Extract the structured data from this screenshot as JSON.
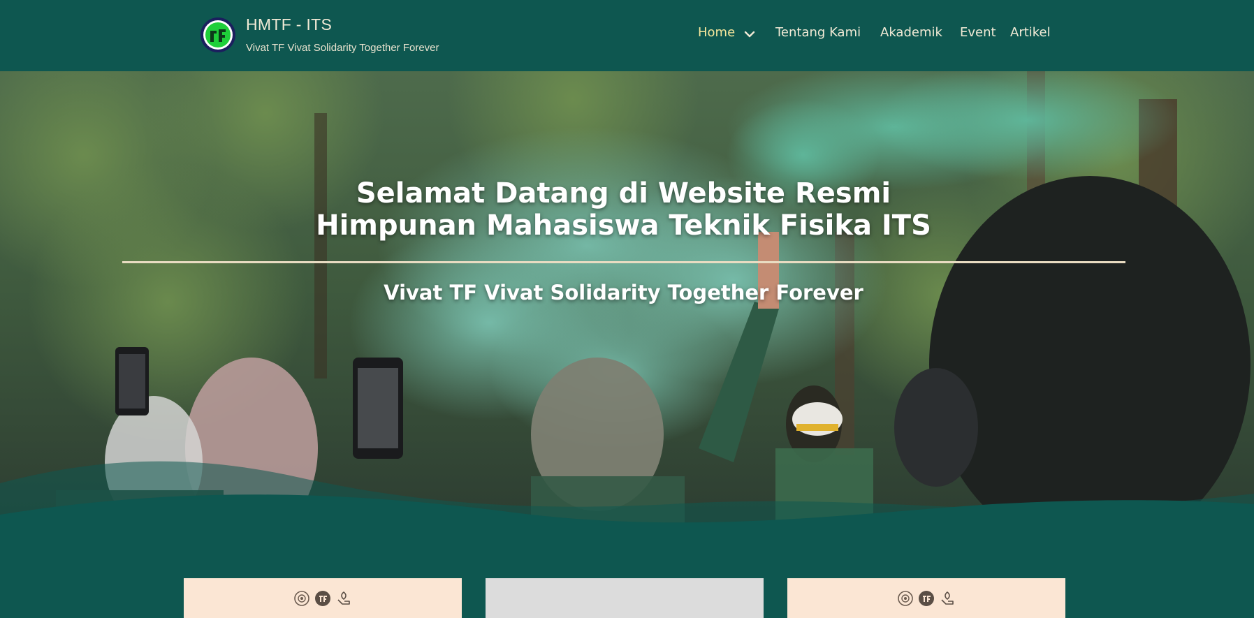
{
  "brand": {
    "title": "HMTF - ITS",
    "tagline": "Vivat TF Vivat Solidarity Together Forever"
  },
  "nav": {
    "items": [
      {
        "label": "Home",
        "active": true,
        "has_dropdown": true
      },
      {
        "label": "Tentang Kami",
        "active": false
      },
      {
        "label": "Akademik",
        "active": false
      },
      {
        "label": "Event",
        "active": false
      },
      {
        "label": "Artikel",
        "active": false
      }
    ]
  },
  "hero": {
    "title_line1": "Selamat Datang di Website Resmi",
    "title_line2": "Himpunan Mahasiswa Teknik Fisika ITS",
    "subtitle": "Vivat TF Vivat Solidarity Together Forever"
  },
  "cards": [
    {
      "variant": "peach",
      "icons": [
        "emblem-icon",
        "tf-logo-icon",
        "leaf-hand-icon"
      ]
    },
    {
      "variant": "gray",
      "icons": []
    },
    {
      "variant": "peach",
      "icons": [
        "emblem-icon",
        "tf-logo-icon",
        "leaf-hand-icon"
      ]
    }
  ],
  "colors": {
    "header_bg": "#0e5750",
    "nav_active": "#f6e79c",
    "nav_text": "#f1ead6",
    "card_peach": "#fbe6d4",
    "card_gray": "#dcdcdc",
    "divider": "#e9dcc2"
  }
}
